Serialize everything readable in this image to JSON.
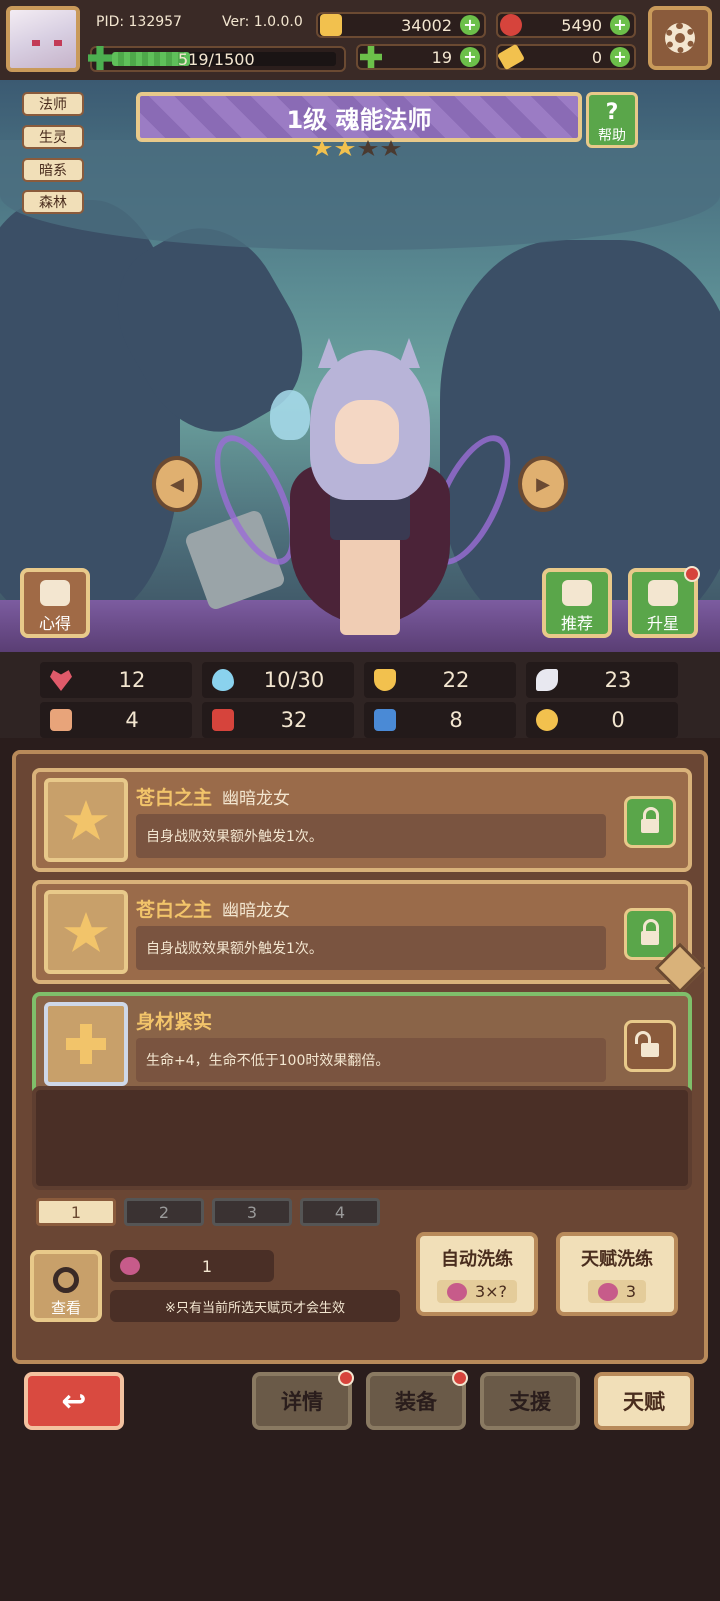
{
  "header": {
    "pid_label": "PID: 132957",
    "version_label": "Ver: 1.0.0.0",
    "energy": "519/1500",
    "energy_fraction": 0.346,
    "gold": "34002",
    "gems": "5490",
    "clover": "19",
    "keys": "0"
  },
  "tags": [
    "法师",
    "生灵",
    "暗系",
    "森林"
  ],
  "character": {
    "title": "1级  魂能法师",
    "stars_filled": 2,
    "stars_total": 4
  },
  "buttons": {
    "help": "帮助",
    "help_glyph": "?",
    "insight": "心得",
    "recommend": "推荐",
    "star_up": "升星",
    "look": "查看",
    "back_glyph": "↩"
  },
  "stats": [
    "12",
    "10/30",
    "22",
    "23",
    "4",
    "32",
    "8",
    "0"
  ],
  "talents": [
    {
      "name": "苍白之主",
      "sub": "幽暗龙女",
      "desc": "自身战败效果额外触发1次。",
      "locked": true
    },
    {
      "name": "苍白之主",
      "sub": "幽暗龙女",
      "desc": "自身战败效果额外触发1次。",
      "locked": true
    },
    {
      "name": "身材紧实",
      "sub": "",
      "desc": "生命+4，生命不低于100时效果翻倍。",
      "locked": false
    }
  ],
  "pages": [
    "1",
    "2",
    "3",
    "4"
  ],
  "cost": {
    "amount": "1",
    "note": "※只有当前所选天赋页才会生效"
  },
  "wash": {
    "auto_label": "自动洗练",
    "auto_cost": "3×?",
    "talent_label": "天赋洗练",
    "talent_cost": "3"
  },
  "nav": [
    "详情",
    "装备",
    "支援",
    "天赋"
  ],
  "colors": {
    "accent": "#e8c98a",
    "panel": "#6a4634",
    "green": "#5aa64a",
    "red": "#d94a40"
  }
}
